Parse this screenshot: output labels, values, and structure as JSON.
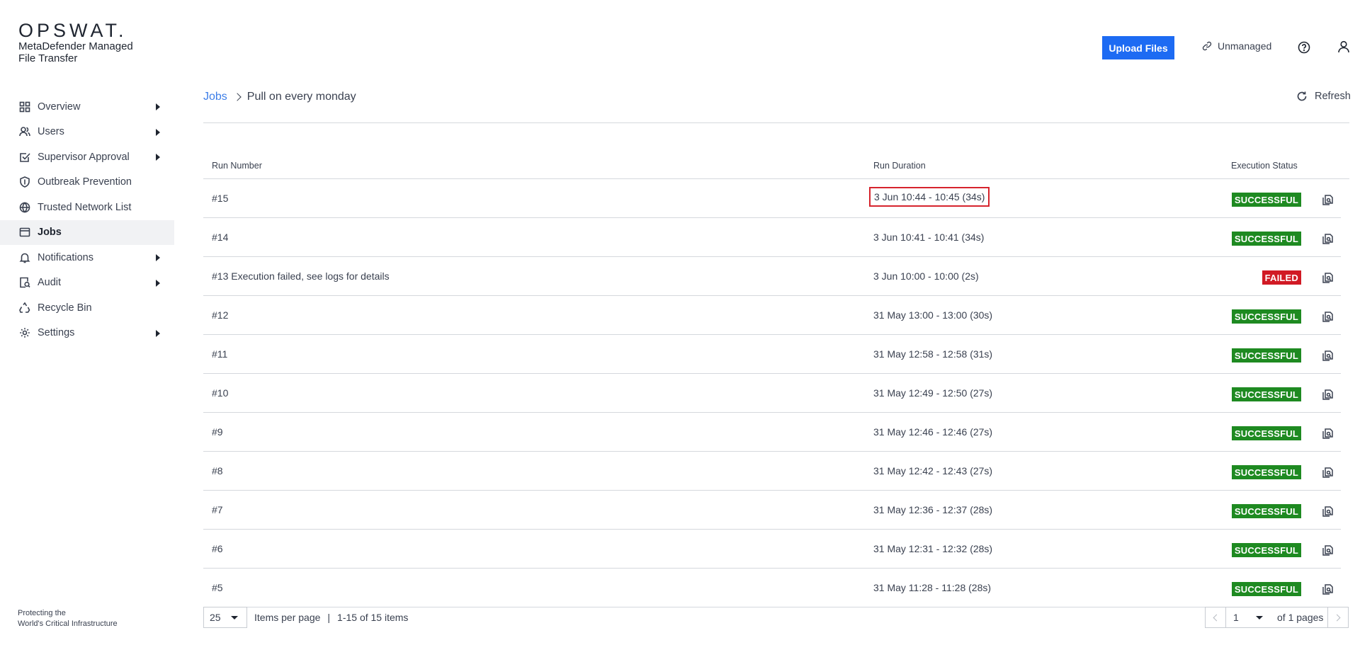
{
  "brand": {
    "logo": "OPSWAT.",
    "product_line1": "MetaDefender Managed",
    "product_line2": "File Transfer",
    "footer_line1": "Protecting the",
    "footer_line2": "World's Critical Infrastructure"
  },
  "sidebar": {
    "items": [
      {
        "label": "Overview",
        "icon": "grid-icon",
        "expandable": true
      },
      {
        "label": "Users",
        "icon": "users-icon",
        "expandable": true
      },
      {
        "label": "Supervisor Approval",
        "icon": "checkbox-icon",
        "expandable": true
      },
      {
        "label": "Outbreak Prevention",
        "icon": "shield-icon",
        "expandable": false
      },
      {
        "label": "Trusted Network List",
        "icon": "globe-icon",
        "expandable": false
      },
      {
        "label": "Jobs",
        "icon": "window-icon",
        "expandable": false,
        "active": true
      },
      {
        "label": "Notifications",
        "icon": "bell-icon",
        "expandable": true
      },
      {
        "label": "Audit",
        "icon": "audit-icon",
        "expandable": true
      },
      {
        "label": "Recycle Bin",
        "icon": "recycle-icon",
        "expandable": false
      },
      {
        "label": "Settings",
        "icon": "gear-icon",
        "expandable": true
      }
    ]
  },
  "header": {
    "upload_label": "Upload Files",
    "unmanaged_label": "Unmanaged"
  },
  "breadcrumb": {
    "parent": "Jobs",
    "current": "Pull on every monday"
  },
  "refresh_label": "Refresh",
  "table": {
    "columns": {
      "run": "Run Number",
      "duration": "Run Duration",
      "status": "Execution Status"
    },
    "rows": [
      {
        "run": "#15",
        "duration": "3 Jun 10:44 - 10:45 (34s)",
        "status": "SUCCESSFUL"
      },
      {
        "run": "#14",
        "duration": "3 Jun 10:41 - 10:41 (34s)",
        "status": "SUCCESSFUL"
      },
      {
        "run": "#13 Execution failed, see logs for details",
        "duration": "3 Jun 10:00 - 10:00 (2s)",
        "status": "FAILED"
      },
      {
        "run": "#12",
        "duration": "31 May 13:00 - 13:00 (30s)",
        "status": "SUCCESSFUL"
      },
      {
        "run": "#11",
        "duration": "31 May 12:58 - 12:58 (31s)",
        "status": "SUCCESSFUL"
      },
      {
        "run": "#10",
        "duration": "31 May 12:49 - 12:50 (27s)",
        "status": "SUCCESSFUL"
      },
      {
        "run": "#9",
        "duration": "31 May 12:46 - 12:46 (27s)",
        "status": "SUCCESSFUL"
      },
      {
        "run": "#8",
        "duration": "31 May 12:42 - 12:43 (27s)",
        "status": "SUCCESSFUL"
      },
      {
        "run": "#7",
        "duration": "31 May 12:36 - 12:37 (28s)",
        "status": "SUCCESSFUL"
      },
      {
        "run": "#6",
        "duration": "31 May 12:31 - 12:32 (28s)",
        "status": "SUCCESSFUL"
      },
      {
        "run": "#5",
        "duration": "31 May 11:28 - 11:28 (28s)",
        "status": "SUCCESSFUL"
      }
    ]
  },
  "pagination": {
    "per_page": "25",
    "per_page_label": "Items per page",
    "separator": "|",
    "range": "1-15 of 15 items",
    "page": "1",
    "of_pages": "of 1 pages"
  },
  "colors": {
    "accent": "#1d6bf3",
    "success": "#1e8a21",
    "failed": "#d11a24",
    "highlight_border": "#d6242d"
  }
}
